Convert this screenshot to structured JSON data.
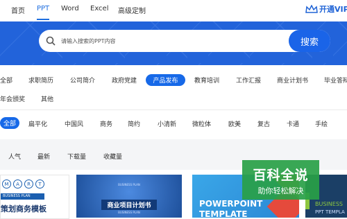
{
  "topnav": {
    "items": [
      "首页",
      "PPT",
      "Word",
      "Excel",
      "高级定制"
    ],
    "vip_label": "开通VIP"
  },
  "search": {
    "placeholder": "请输入搜索的PPT内容",
    "button_label": "搜索"
  },
  "categories_row1": [
    "全部",
    "求职简历",
    "公司简介",
    "政府党建",
    "产品发布",
    "教育培训",
    "工作汇报",
    "商业计划书",
    "毕业答辩"
  ],
  "categories_row1_selected": "产品发布",
  "categories_row2": [
    "年会颁奖",
    "其他"
  ],
  "styles_row": [
    "全部",
    "扁平化",
    "中国风",
    "商务",
    "简约",
    "小清新",
    "微粒体",
    "欧美",
    "复古",
    "卡通",
    "手绘"
  ],
  "styles_row_selected": "全部",
  "sort_row": [
    "人气",
    "最新",
    "下载量",
    "收藏量"
  ],
  "thumbs": [
    {
      "letters": [
        "M",
        "A",
        "R",
        "T"
      ],
      "tag": "BUSINESS PLAN",
      "title": "策划商务模板"
    },
    {
      "small": "BUSINESS PLAN",
      "title": "商业项目计划书",
      "sub": "BUSINESS PLAN"
    },
    {
      "title": "POWERPOINT",
      "title2": "TEMPLATE"
    },
    {
      "title": "BUSINESS",
      "sub": "PPT TEMPLA"
    }
  ],
  "watermark": {
    "title": "百科全说",
    "subtitle": "助你轻松解决"
  },
  "colors": {
    "brand_blue": "#1f6fe0",
    "hero_bg": "#2263da",
    "pill_bg": "#1769e8",
    "watermark_green": "#28a046"
  }
}
